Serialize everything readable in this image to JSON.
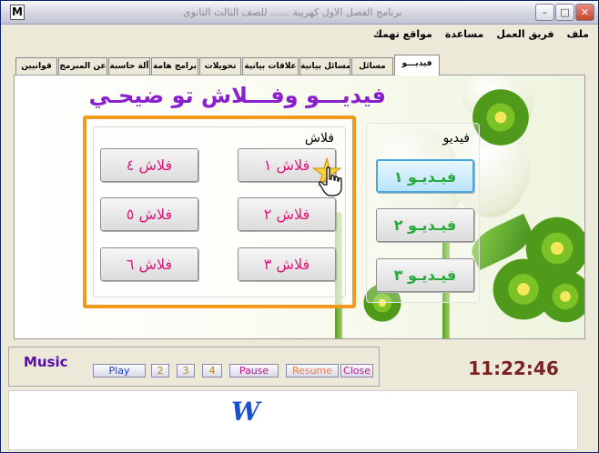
{
  "window": {
    "title": "برنامج الفصل الاول كهربية ...... للصف الثالث الثانوى",
    "app_icon": "M",
    "controls": {
      "minimize": "–",
      "maximize": "□",
      "close": "✕"
    }
  },
  "menubar": {
    "items": [
      "ملف",
      "فريق العمل",
      "مساعدة",
      "مواقع تهمك"
    ]
  },
  "tabs": {
    "items": [
      "فيديـــو",
      "مسائل",
      "مسائل بيانية",
      "علاقات بيانية",
      "تحويلات",
      "برامج هامة",
      "آلة حاسبة",
      "عن المبرمج",
      "قوانيين"
    ],
    "active_index": 0
  },
  "main": {
    "heading": "فيديـــو  وفـــلاش تو ضيحـي",
    "flash_group": {
      "label": "فلاش",
      "buttons": [
        "فلاش ١",
        "فلاش ٢",
        "فلاش ٣",
        "فلاش ٤",
        "فلاش ٥",
        "فلاش ٦"
      ]
    },
    "video_group": {
      "label": "فيديو",
      "buttons": [
        "فيـديـو ١",
        "فيـديـو ٢",
        "فيـديـو ٣"
      ]
    }
  },
  "music": {
    "label": "Music",
    "buttons": {
      "play": "Play",
      "b2": "2",
      "b3": "3",
      "b4": "4",
      "pause": "Pause",
      "resume": "Resume",
      "close": "Close"
    }
  },
  "clock": "11:22:46",
  "footer": {
    "logo": "W"
  },
  "colors": {
    "heading": "#8a1fd0",
    "flash_text": "#e0177a",
    "video_text": "#27a83a",
    "frame_orange": "#f39a1e",
    "clock": "#7a2222",
    "music_label": "#5a0ca8",
    "logo": "#1a4fd0"
  }
}
